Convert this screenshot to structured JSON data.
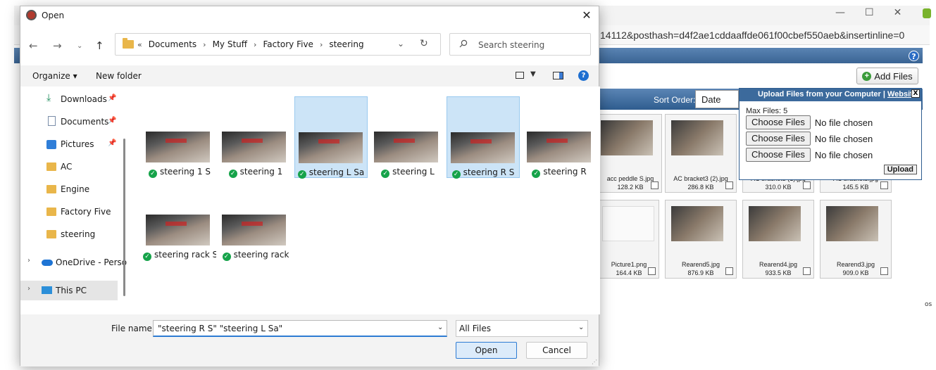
{
  "browser": {
    "url_fragment": "14112&posthash=d4f2ae1cddaaffde061f00cbef550aeb&insertinline=0",
    "help": "?",
    "add_files": "Add Files",
    "sort_label": "Sort Order:",
    "sort_value": "Date",
    "partial_label": "os",
    "tiles": [
      {
        "name": "acc peddle S.jpg",
        "size": "128.2 KB"
      },
      {
        "name": "AC bracket3 (2).jpg",
        "size": "286.8 KB"
      },
      {
        "name": "AC bracket3 (1).jpg",
        "size": "310.0 KB"
      },
      {
        "name": "AC bracket3.jpg",
        "size": "145.5 KB"
      },
      {
        "name": "Picture1.png",
        "size": "164.4 KB"
      },
      {
        "name": "Rearend5.jpg",
        "size": "876.9 KB"
      },
      {
        "name": "Rearend4.jpg",
        "size": "933.5 KB"
      },
      {
        "name": "Rearend3.jpg",
        "size": "909.0 KB"
      }
    ],
    "upload_panel": {
      "title": "Upload Files from your Computer | ",
      "title_link": "Website",
      "close": "X",
      "max_files": "Max Files: 5",
      "choose_label": "Choose Files",
      "no_file": "No file chosen",
      "upload": "Upload"
    }
  },
  "dialog": {
    "title": "Open",
    "breadcrumbs": [
      "Documents",
      "My Stuff",
      "Factory Five",
      "steering"
    ],
    "crumb_prefix": "«",
    "search_placeholder": "Search steering",
    "organize": "Organize ▾",
    "new_folder": "New folder",
    "sidebar": [
      {
        "label": "Downloads",
        "pinned": true,
        "icon": "download-icon"
      },
      {
        "label": "Documents",
        "pinned": true,
        "icon": "document-icon"
      },
      {
        "label": "Pictures",
        "pinned": true,
        "icon": "pictures-icon"
      },
      {
        "label": "AC",
        "pinned": false,
        "icon": "folder-icon"
      },
      {
        "label": "Engine",
        "pinned": false,
        "icon": "folder-icon"
      },
      {
        "label": "Factory Five",
        "pinned": false,
        "icon": "folder-icon"
      },
      {
        "label": "steering",
        "pinned": false,
        "icon": "folder-icon"
      },
      {
        "label": "OneDrive - Perso",
        "pinned": false,
        "icon": "onedrive-icon"
      },
      {
        "label": "This PC",
        "pinned": false,
        "icon": "computer-icon"
      }
    ],
    "files": [
      {
        "name": "steering 1 S",
        "selected": false
      },
      {
        "name": "steering 1",
        "selected": false
      },
      {
        "name": "steering L Sa",
        "selected": true
      },
      {
        "name": "steering L",
        "selected": false
      },
      {
        "name": "steering R S",
        "selected": true
      },
      {
        "name": "steering R",
        "selected": false
      },
      {
        "name": "steering rack S",
        "selected": false
      },
      {
        "name": "steering rack",
        "selected": false
      }
    ],
    "filename_label": "File name:",
    "filename_value": "\"steering R S\" \"steering L Sa\"",
    "filetype": "All Files",
    "open": "Open",
    "cancel": "Cancel"
  }
}
